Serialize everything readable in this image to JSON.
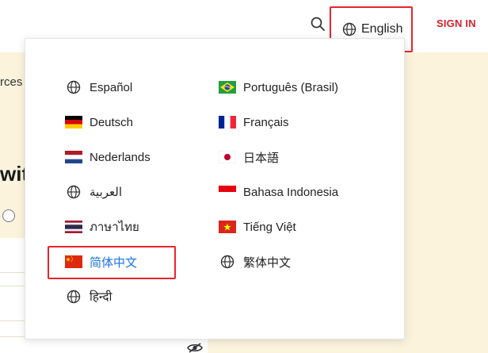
{
  "header": {
    "language_label": "English",
    "signin_label": "SIGN IN"
  },
  "background": {
    "snippet": "rces",
    "heading": "with"
  },
  "languages": [
    {
      "label": "Español",
      "icon": "globe-icon"
    },
    {
      "label": "Português (Brasil)",
      "icon": "flag-brazil-icon"
    },
    {
      "label": "Deutsch",
      "icon": "flag-germany-icon"
    },
    {
      "label": "Français",
      "icon": "flag-france-icon"
    },
    {
      "label": "Nederlands",
      "icon": "flag-netherlands-icon"
    },
    {
      "label": "日本語",
      "icon": "flag-japan-icon"
    },
    {
      "label": "العربية",
      "icon": "globe-icon"
    },
    {
      "label": "Bahasa Indonesia",
      "icon": "flag-indonesia-icon"
    },
    {
      "label": "ภาษาไทย",
      "icon": "flag-thailand-icon"
    },
    {
      "label": "Tiếng Việt",
      "icon": "flag-vietnam-icon"
    },
    {
      "label": "简体中文",
      "icon": "flag-china-icon",
      "selected": true
    },
    {
      "label": "繁体中文",
      "icon": "globe-icon"
    },
    {
      "label": "हिन्दी",
      "icon": "globe-icon"
    }
  ],
  "colors": {
    "accent_red": "#e8252b",
    "selected_text": "#1a73e8",
    "page_background": "#fbf3dc"
  }
}
